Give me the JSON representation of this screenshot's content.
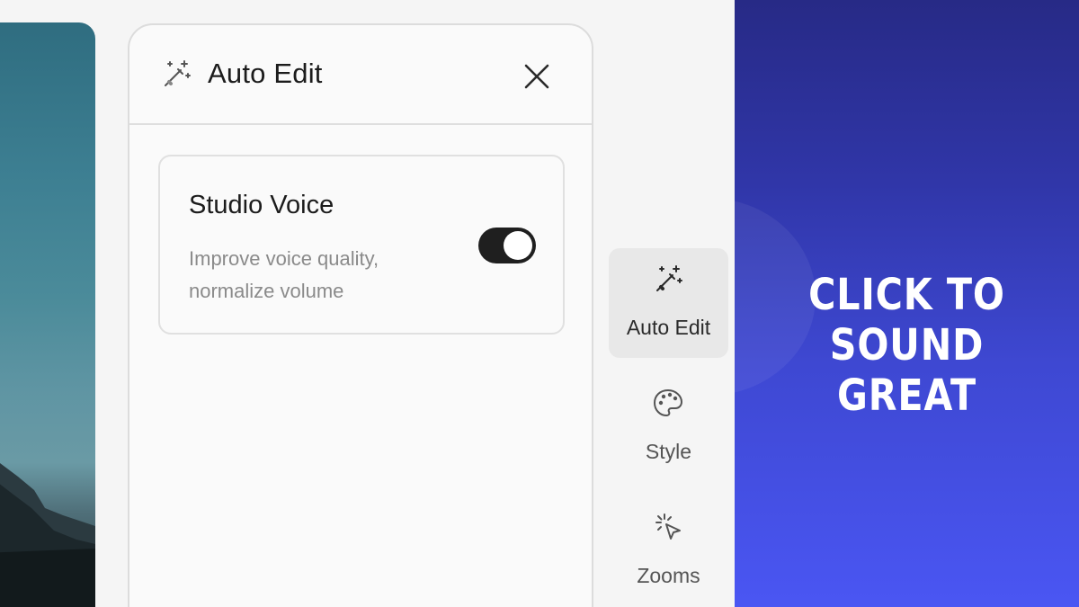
{
  "panel": {
    "title": "Auto Edit",
    "header_icon": "magic-wand-icon",
    "close_icon": "close-icon"
  },
  "feature": {
    "title": "Studio Voice",
    "description": "Improve voice quality, normalize volume",
    "enabled": true
  },
  "sidebar": {
    "items": [
      {
        "label": "Auto Edit",
        "icon": "magic-wand-icon",
        "active": true
      },
      {
        "label": "Style",
        "icon": "palette-icon",
        "active": false
      },
      {
        "label": "Zooms",
        "icon": "cursor-click-icon",
        "active": false
      }
    ]
  },
  "promo": {
    "line1": "CLICK TO",
    "line2": "SOUND GREAT"
  },
  "colors": {
    "toggle_on": "#1f1f1f",
    "promo_top": "#272a86",
    "promo_bottom": "#4a56f3"
  }
}
